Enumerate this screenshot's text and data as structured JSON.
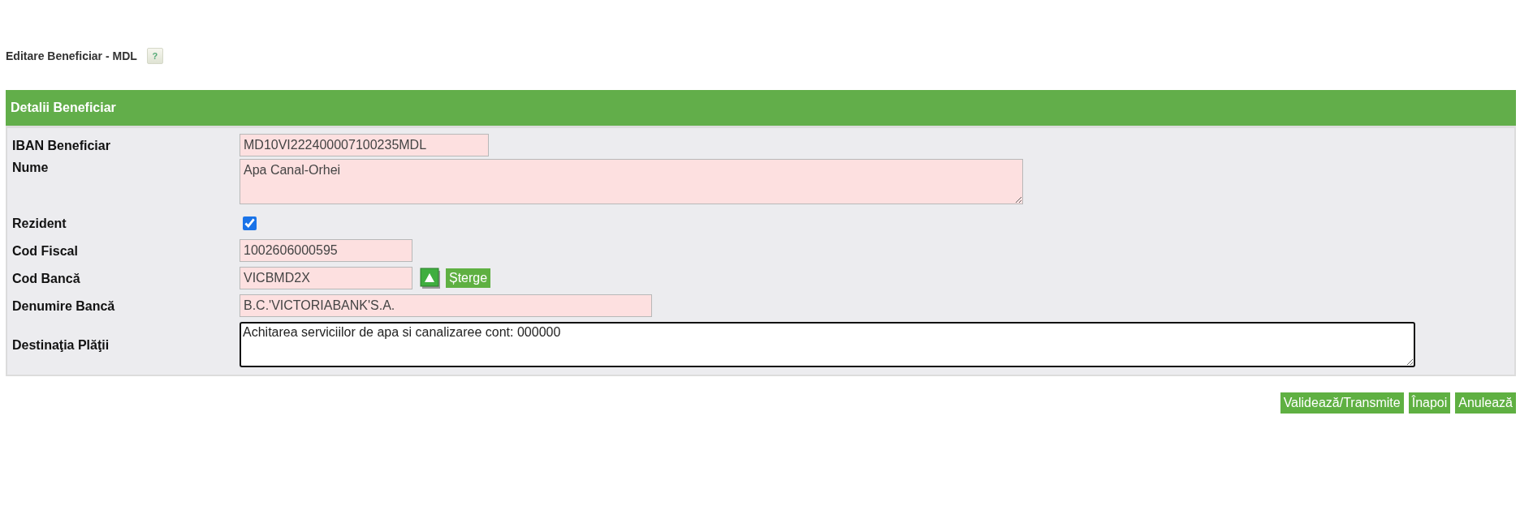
{
  "page": {
    "title": "Editare Beneficiar - MDL",
    "help": "?"
  },
  "panel": {
    "title": "Detalii Beneficiar",
    "fields": [
      {
        "kind": "input",
        "label": "IBAN Beneficiar",
        "value": "MD10VI222400007100235MDL"
      },
      {
        "kind": "textarea",
        "label": "Nume",
        "value": "Apa Canal-Orhei",
        "focused": false
      },
      {
        "kind": "checkbox",
        "label": "Rezident",
        "checked": true
      },
      {
        "kind": "input",
        "label": "Cod Fiscal",
        "value": "1002606000595"
      },
      {
        "kind": "lookup",
        "label": "Cod Bancă",
        "value": "VICBMD2X",
        "button": "Șterge"
      },
      {
        "kind": "input",
        "label": "Denumire Bancă",
        "value": "B.C.'VICTORIABANK'S.A."
      },
      {
        "kind": "textarea",
        "label": "Destinaţia Plăţii",
        "value": "Achitarea serviciilor de apa si canalizaree cont: 000000",
        "focused": true
      }
    ]
  },
  "buttons": [
    "Validează/Transmite",
    "Înapoi",
    "Anulează"
  ]
}
